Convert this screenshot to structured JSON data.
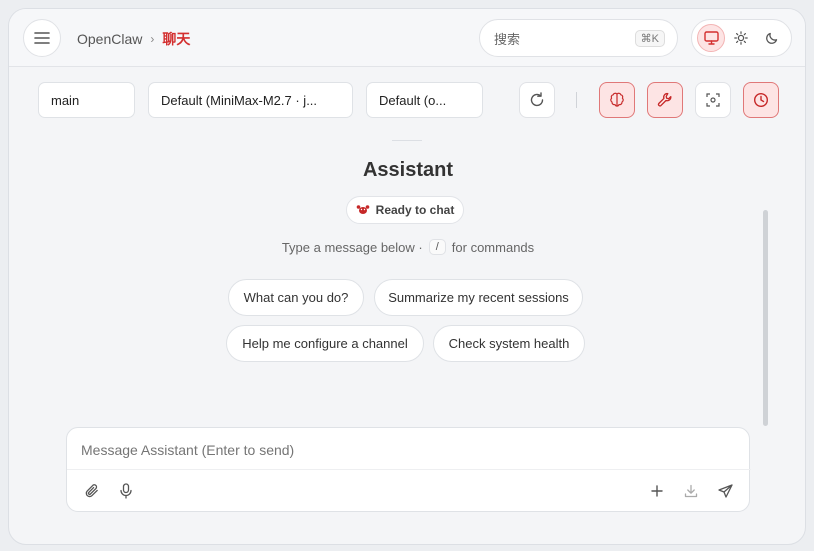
{
  "header": {
    "breadcrumb_root": "OpenClaw",
    "breadcrumb_sep": "›",
    "breadcrumb_current": "聊天",
    "search_placeholder": "搜索",
    "search_shortcut": "⌘K"
  },
  "controls": {
    "session_select": "main",
    "model_select": "Default (MiniMax-M2.7 · j...",
    "thinking_select": "Default (o..."
  },
  "chat": {
    "title": "Assistant",
    "status": "Ready to chat",
    "hint_before": "Type a message below ·",
    "hint_key": "/",
    "hint_after": "for commands",
    "suggestions": [
      "What can you do?",
      "Summarize my recent sessions",
      "Help me configure a channel",
      "Check system health"
    ]
  },
  "composer": {
    "placeholder": "Message Assistant (Enter to send)"
  },
  "colors": {
    "accent": "#d32f2f",
    "accent_bg": "#fde4e4"
  },
  "icons": [
    "menu-icon",
    "monitor-icon",
    "sun-icon",
    "moon-icon",
    "refresh-icon",
    "brain-icon",
    "wrench-icon",
    "focus-icon",
    "clock-icon",
    "lobster-icon",
    "paperclip-icon",
    "mic-icon",
    "plus-icon",
    "download-icon",
    "send-icon"
  ]
}
